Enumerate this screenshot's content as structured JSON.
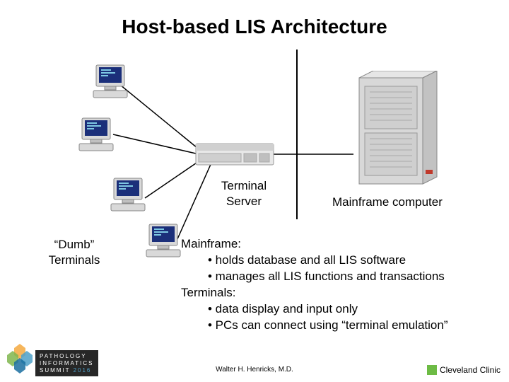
{
  "title": "Host-based LIS Architecture",
  "labels": {
    "terminal_server": "Terminal\nServer",
    "mainframe_computer": "Mainframe computer",
    "dumb_terminals": "“Dumb”\nTerminals"
  },
  "bullets": {
    "line1": "Mainframe:",
    "line2": "• holds database and all LIS software",
    "line3": "• manages all LIS functions and transactions",
    "line4": "Terminals:",
    "line5": "• data display and input only",
    "line6": "• PCs can connect using “terminal emulation”"
  },
  "footer": {
    "author": "Walter H. Henricks, M.D.",
    "org": "Cleveland Clinic",
    "conference_top": "PATHOLOGY",
    "conference_mid": "INFORMATICS",
    "conference_bot_left": "SUMMIT",
    "conference_bot_right": "2016"
  }
}
